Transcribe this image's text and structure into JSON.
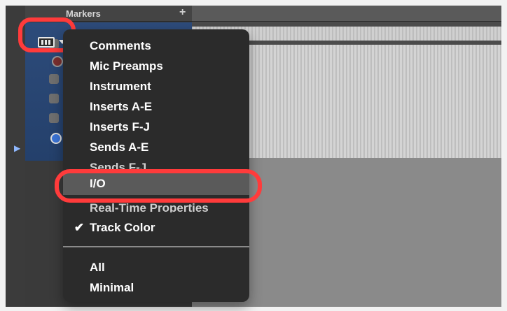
{
  "header": {
    "markers_label": "Markers",
    "add_label": "+"
  },
  "menu": {
    "items": [
      {
        "label": "Comments",
        "checked": false
      },
      {
        "label": "Mic Preamps",
        "checked": false
      },
      {
        "label": "Instrument",
        "checked": false
      },
      {
        "label": "Inserts A-E",
        "checked": false
      },
      {
        "label": "Inserts F-J",
        "checked": false
      },
      {
        "label": "Sends A-E",
        "checked": false
      },
      {
        "label": "Sends F-J",
        "checked": false
      },
      {
        "label": "I/O",
        "checked": false,
        "highlighted": true
      },
      {
        "label": "Real-Time Properties",
        "checked": false
      },
      {
        "label": "Track Color",
        "checked": true
      }
    ],
    "presets": [
      {
        "label": "All"
      },
      {
        "label": "Minimal"
      }
    ],
    "check_glyph": "✔"
  },
  "icons": {
    "view_button": "column-view-icon",
    "dropdown": "chevron-down-icon"
  },
  "colors": {
    "highlight_ring": "#ff3b3b",
    "menu_bg": "#2b2b2b",
    "menu_highlight": "#5a5a5a"
  }
}
